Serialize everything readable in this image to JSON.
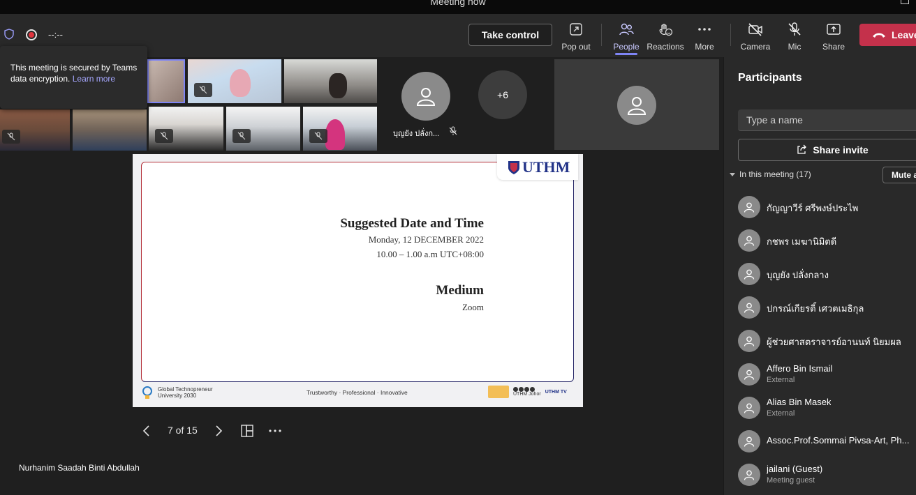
{
  "window": {
    "title": "Meeting now"
  },
  "toolbar": {
    "timer": "--:--",
    "take_control_label": "Take control",
    "buttons": [
      {
        "label": "Pop out",
        "icon": "pop-out-icon"
      },
      {
        "label": "People",
        "icon": "people-icon",
        "active": true
      },
      {
        "label": "Reactions",
        "icon": "reactions-icon"
      },
      {
        "label": "More",
        "icon": "more-icon"
      },
      {
        "label": "Camera",
        "icon": "camera-off-icon"
      },
      {
        "label": "Mic",
        "icon": "mic-off-icon"
      },
      {
        "label": "Share",
        "icon": "share-icon"
      }
    ],
    "leave_label": "Leave",
    "colors": {
      "leave": "#c4314b",
      "accent": "#7f85f5"
    }
  },
  "security_popup": {
    "text": "This meeting is secured by Teams data encryption.",
    "link": "Learn more"
  },
  "gallery": {
    "participant_name": "บุญยัง ปลั่งก...",
    "overflow_count": "+6"
  },
  "slide": {
    "logo": "UTHM",
    "heading": "Suggested Date and Time",
    "date": "Monday, 12 DECEMBER 2022",
    "time": "10.00 – 1.00 a.m UTC+08:00",
    "medium_heading": "Medium",
    "medium_value": "Zoom",
    "footer_left_line1": "Global Technopreneur",
    "footer_left_line2": "University 2030",
    "tagline": "Trustworthy · Professional · Innovative",
    "footer_right_a": "UTHM Johor",
    "footer_right_b": "UTHM TV"
  },
  "slide_nav": {
    "counter": "7 of 15"
  },
  "presenter": {
    "name": "Nurhanim Saadah Binti Abdullah"
  },
  "participants_panel": {
    "title": "Participants",
    "search_placeholder": "Type a name",
    "share_invite_label": "Share invite",
    "in_meeting_label": "In this meeting (17)",
    "mute_all_label": "Mute a",
    "people": [
      {
        "name": "กัญญาวีร์ ศรีพงษ์ประไพ",
        "sub": ""
      },
      {
        "name": "กชพร เมฆานิมิตดี",
        "sub": ""
      },
      {
        "name": "บุญยัง ปลั่งกลาง",
        "sub": ""
      },
      {
        "name": "ปกรณ์เกียรติ์ เศวตเมธิกุล",
        "sub": ""
      },
      {
        "name": "ผู้ช่วยศาสตราจารย์อานนท์ นิยมผล",
        "sub": ""
      },
      {
        "name": "Affero Bin Ismail",
        "sub": "External"
      },
      {
        "name": "Alias Bin Masek",
        "sub": "External"
      },
      {
        "name": "Assoc.Prof.Sommai Pivsa-Art, Ph...",
        "sub": ""
      },
      {
        "name": "jailani (Guest)",
        "sub": "Meeting guest"
      }
    ]
  }
}
